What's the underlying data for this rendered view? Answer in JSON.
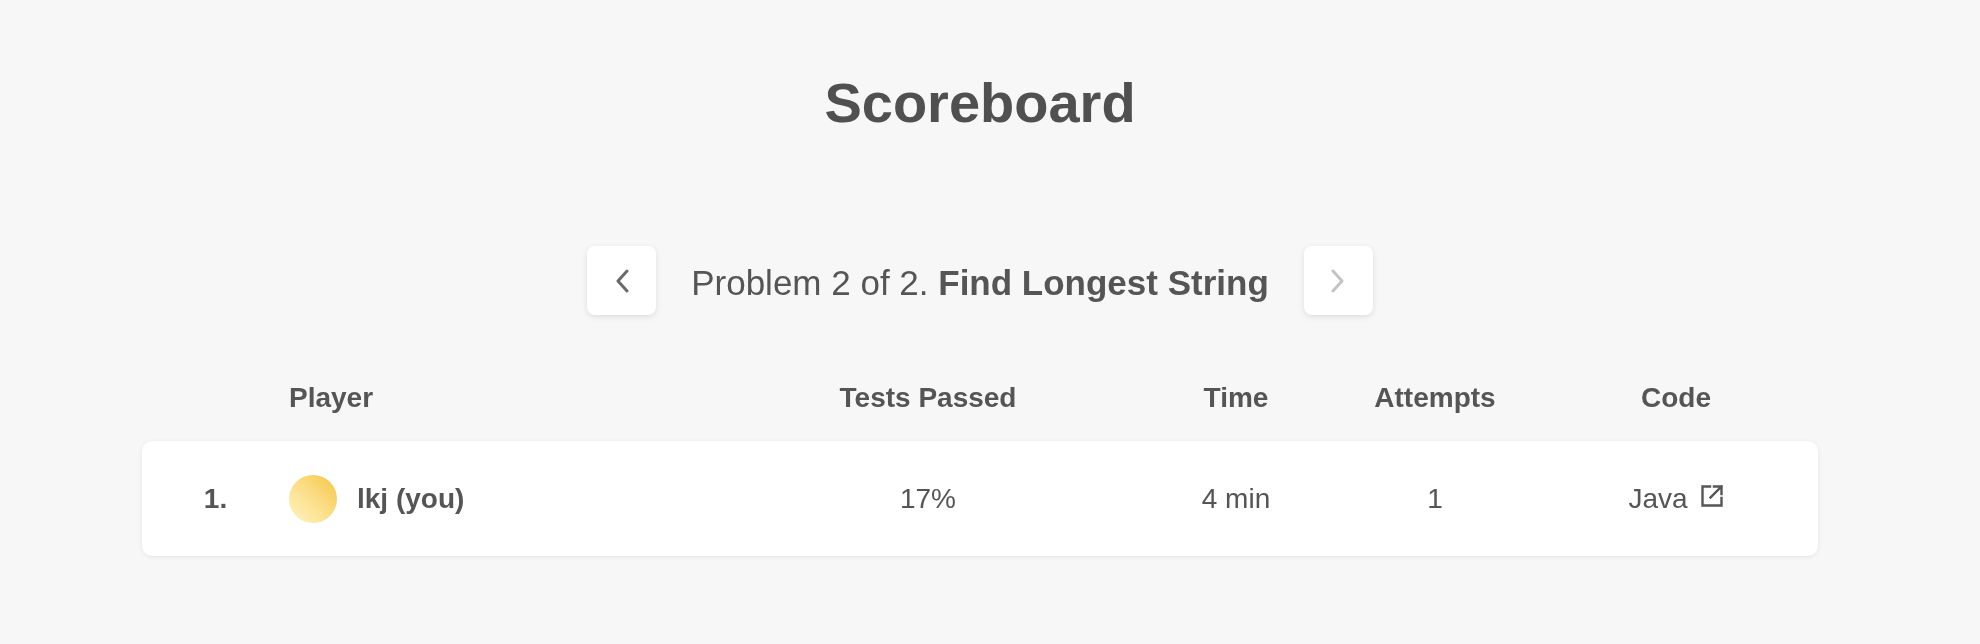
{
  "title": "Scoreboard",
  "problem_nav": {
    "prev_button": {
      "disabled": false
    },
    "label": "Problem 2 of 2. **Find Longest String**",
    "next_button": {
      "disabled": true
    }
  },
  "table": {
    "columns": [
      "Player",
      "Tests Passed",
      "Time",
      "Attempts",
      "Code"
    ],
    "rows": [
      {
        "rank": "1.",
        "player": "lkj (you)",
        "tests_passed": "17%",
        "time": "4 min",
        "attempts": "1",
        "code": "Java"
      }
    ]
  }
}
